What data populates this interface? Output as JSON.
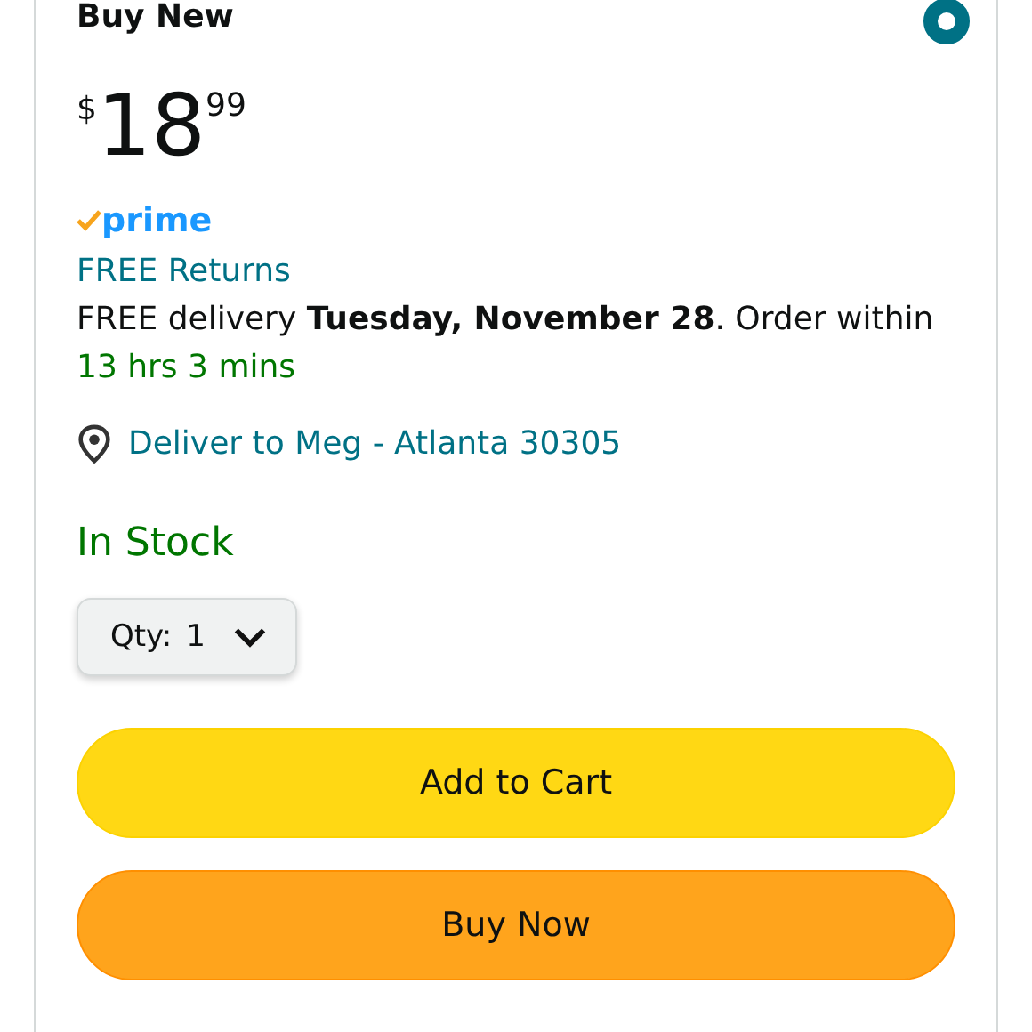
{
  "offer": {
    "title": "Buy New",
    "selected": true
  },
  "price": {
    "currency": "$",
    "whole": "18",
    "fraction": "99"
  },
  "prime": {
    "label": "prime"
  },
  "returns": "FREE Returns",
  "delivery": "FREE delivery **Tuesday, November 28**. Order within",
  "countdown": "13 hrs 3 mins",
  "location": "Deliver to Meg - Atlanta 30305",
  "stock": "In Stock",
  "quantity": {
    "label": "Qty:",
    "value": "1"
  },
  "buttons": [
    {
      "label": "Add to Cart",
      "kind": "cart"
    },
    {
      "label": "Buy Now",
      "kind": "buy"
    }
  ]
}
